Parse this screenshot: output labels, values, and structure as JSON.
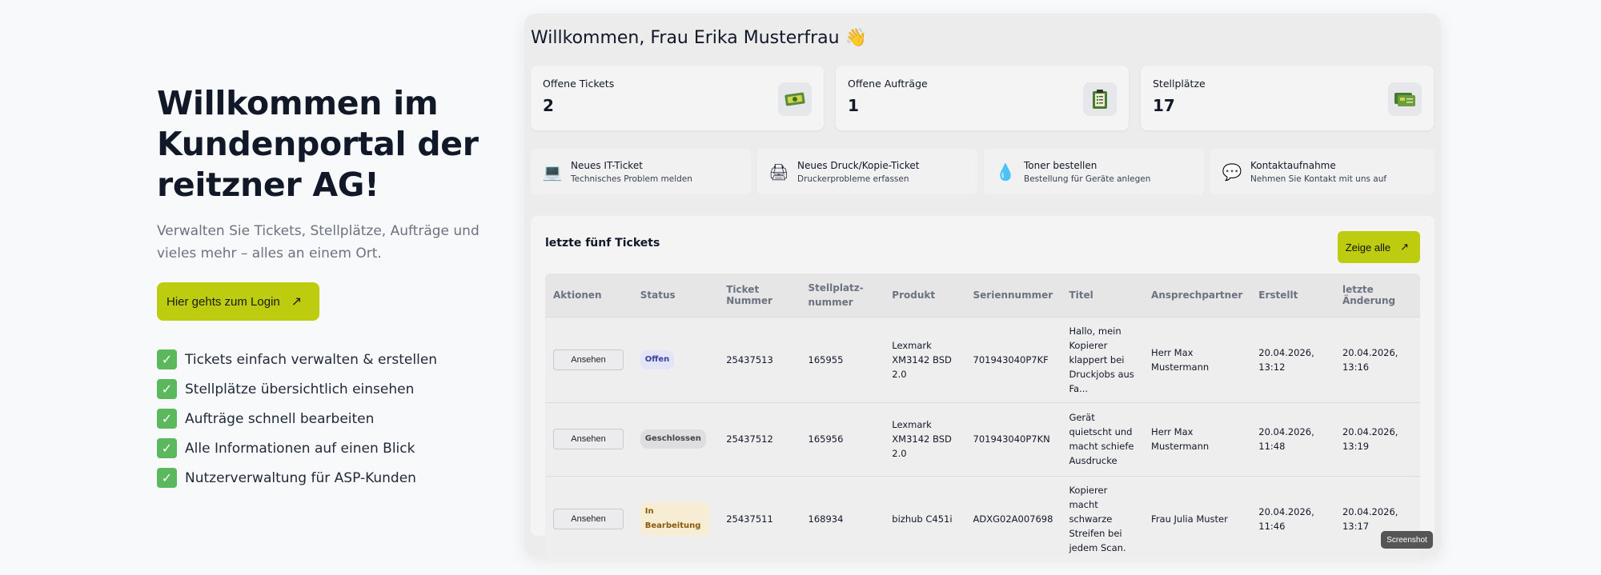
{
  "hero": {
    "title": "Willkommen im Kundenportal der reitzner AG!",
    "subtitle": "Verwalten Sie Tickets, Stellplätze, Aufträge und vieles mehr – alles an einem Ort.",
    "login_label": "Hier gehts zum Login",
    "features": [
      "Tickets einfach verwalten & erstellen",
      "Stellplätze übersichtlich einsehen",
      "Aufträge schnell bearbeiten",
      "Alle Informationen auf einen Blick",
      "Nutzerverwaltung für ASP-Kunden"
    ]
  },
  "dashboard": {
    "welcome": "Willkommen, Frau Erika Musterfrau 👋",
    "stats": [
      {
        "label": "Offene Tickets",
        "value": "2",
        "icon": "ticket-icon"
      },
      {
        "label": "Offene Aufträge",
        "value": "1",
        "icon": "clipboard-icon"
      },
      {
        "label": "Stellplätze",
        "value": "17",
        "icon": "card-icon"
      }
    ],
    "quick_actions": [
      {
        "title": "Neues IT-Ticket",
        "subtitle": "Technisches Problem melden",
        "icon": "laptop-icon"
      },
      {
        "title": "Neues Druck/Kopie-Ticket",
        "subtitle": "Druckerprobleme erfassen",
        "icon": "printer-icon"
      },
      {
        "title": "Toner bestellen",
        "subtitle": "Bestellung für Geräte anlegen",
        "icon": "droplet-icon"
      },
      {
        "title": "Kontaktaufnahme",
        "subtitle": "Nehmen Sie Kontakt mit uns auf",
        "icon": "speech-bubble-icon"
      }
    ],
    "tickets": {
      "title": "letzte fünf Tickets",
      "show_all": "Zeige alle",
      "columns": [
        "Aktionen",
        "Status",
        "Ticket Nummer",
        "Stellplatz-nummer",
        "Produkt",
        "Seriennummer",
        "Titel",
        "Ansprechpartner",
        "Erstellt",
        "letzte Änderung"
      ],
      "rows": [
        {
          "action": "Ansehen",
          "status": "Offen",
          "number": "25437513",
          "stellplatz": "165955",
          "produkt": "Lexmark XM3142 BSD 2.0",
          "serial": "701943040P7KF",
          "titel": "Hallo, mein Kopierer klappert bei Druckjobs aus Fa...",
          "kontakt": "Herr Max Mustermann",
          "erstellt": "20.04.2026, 13:12",
          "geaendert": "20.04.2026, 13:16"
        },
        {
          "action": "Ansehen",
          "status": "Geschlossen",
          "number": "25437512",
          "stellplatz": "165956",
          "produkt": "Lexmark XM3142 BSD 2.0",
          "serial": "701943040P7KN",
          "titel": "Gerät quietscht und macht schiefe Ausdrucke",
          "kontakt": "Herr Max Mustermann",
          "erstellt": "20.04.2026, 11:48",
          "geaendert": "20.04.2026, 13:19"
        },
        {
          "action": "Ansehen",
          "status": "In Bearbeitung",
          "number": "25437511",
          "stellplatz": "168934",
          "produkt": "bizhub C451i",
          "serial": "ADXG02A007698",
          "titel": "Kopierer macht schwarze Streifen bei jedem Scan.",
          "kontakt": "Frau Julia Muster",
          "erstellt": "20.04.2026, 11:46",
          "geaendert": "20.04.2026, 13:17"
        }
      ]
    },
    "screenshot_label": "Screenshot"
  },
  "colors": {
    "accent": "#bdcc0e",
    "check": "#5cb85c"
  }
}
